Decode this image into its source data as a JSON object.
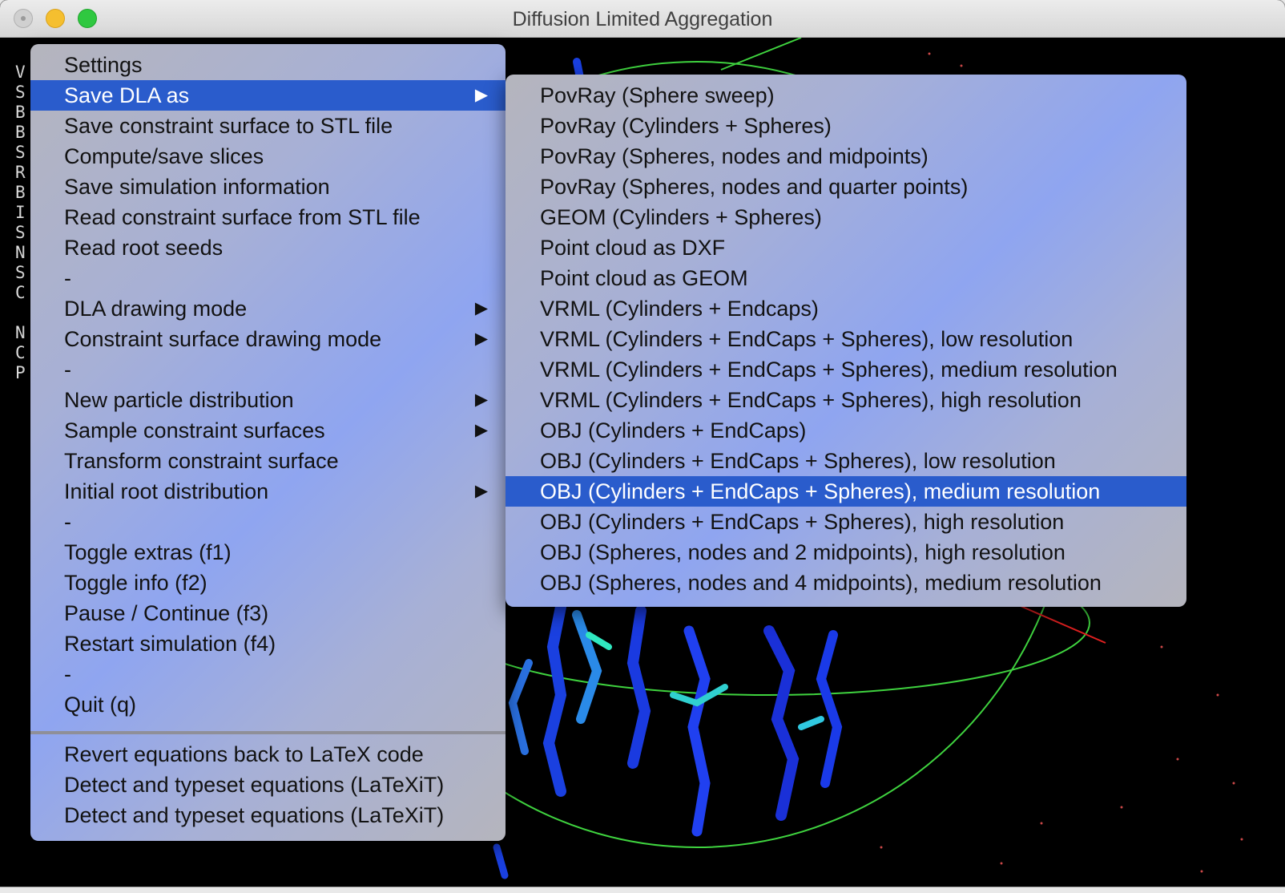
{
  "window": {
    "title": "Diffusion Limited Aggregation"
  },
  "side_letters": [
    "V",
    "S",
    "B",
    "B",
    "S",
    "R",
    "B",
    "I",
    "S",
    "N",
    "S",
    "C",
    "",
    "N",
    "C",
    "P"
  ],
  "main_menu": {
    "items": [
      {
        "label": "Settings"
      },
      {
        "label": "Save DLA as",
        "arrow": "▶",
        "active": true
      },
      {
        "label": "Save constraint surface to STL file"
      },
      {
        "label": "Compute/save slices"
      },
      {
        "label": "Save simulation information"
      },
      {
        "label": "Read constraint surface from STL file"
      },
      {
        "label": "Read root seeds"
      },
      {
        "label": "-"
      },
      {
        "label": "DLA drawing mode",
        "arrow": "▶"
      },
      {
        "label": "Constraint surface drawing mode",
        "arrow": "▶"
      },
      {
        "label": "-"
      },
      {
        "label": "New particle distribution",
        "arrow": "▶"
      },
      {
        "label": "Sample constraint surfaces",
        "arrow": "▶"
      },
      {
        "label": "Transform constraint surface"
      },
      {
        "label": "Initial root distribution",
        "arrow": "▶"
      },
      {
        "label": "-"
      },
      {
        "label": "Toggle extras (f1)"
      },
      {
        "label": "Toggle info (f2)"
      },
      {
        "label": "Pause / Continue (f3)"
      },
      {
        "label": "Restart simulation (f4)"
      },
      {
        "label": "-"
      },
      {
        "label": "Quit (q)"
      }
    ],
    "service_items": [
      {
        "label": "Revert equations back to LaTeX code"
      },
      {
        "label": "Detect and typeset equations (LaTeXiT)"
      },
      {
        "label": "Detect and typeset equations (LaTeXiT)"
      }
    ]
  },
  "submenu": {
    "items": [
      {
        "label": "PovRay (Sphere sweep)"
      },
      {
        "label": "PovRay (Cylinders + Spheres)"
      },
      {
        "label": "PovRay (Spheres, nodes and midpoints)"
      },
      {
        "label": "PovRay (Spheres, nodes and quarter points)"
      },
      {
        "label": "GEOM (Cylinders + Spheres)"
      },
      {
        "label": "Point cloud as DXF"
      },
      {
        "label": "Point cloud as GEOM"
      },
      {
        "label": "VRML (Cylinders + Endcaps)"
      },
      {
        "label": "VRML (Cylinders + EndCaps + Spheres), low resolution"
      },
      {
        "label": "VRML (Cylinders + EndCaps + Spheres), medium resolution"
      },
      {
        "label": "VRML (Cylinders + EndCaps + Spheres), high resolution"
      },
      {
        "label": "OBJ (Cylinders + EndCaps)"
      },
      {
        "label": "OBJ (Cylinders + EndCaps + Spheres), low resolution"
      },
      {
        "label": "OBJ (Cylinders + EndCaps + Spheres), medium resolution",
        "active": true
      },
      {
        "label": "OBJ (Cylinders + EndCaps + Spheres), high resolution"
      },
      {
        "label": "OBJ (Spheres, nodes and 2 midpoints), high resolution"
      },
      {
        "label": "OBJ (Spheres, nodes and 4 midpoints), medium resolution"
      }
    ]
  }
}
